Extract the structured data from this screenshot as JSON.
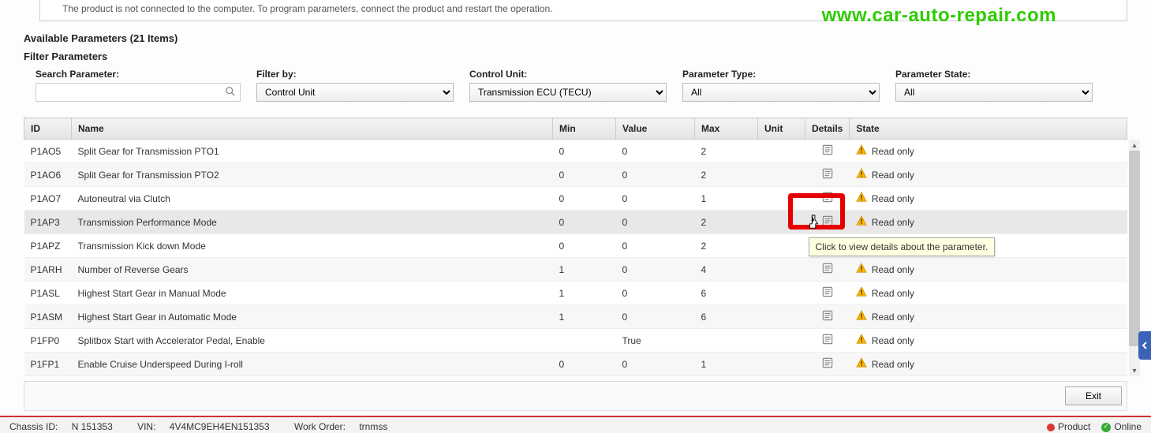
{
  "notice_text": "The product is not connected to the computer. To program parameters, connect the product and restart the operation.",
  "watermark": "www.car-auto-repair.com",
  "available_title": "Available Parameters (21 Items)",
  "filter_title": "Filter Parameters",
  "filters": {
    "search_label": "Search Parameter:",
    "search_value": "",
    "filterby_label": "Filter by:",
    "filterby_value": "Control Unit",
    "controlunit_label": "Control Unit:",
    "controlunit_value": "Transmission ECU (TECU)",
    "ptype_label": "Parameter Type:",
    "ptype_value": "All",
    "pstate_label": "Parameter State:",
    "pstate_value": "All"
  },
  "columns": {
    "id": "ID",
    "name": "Name",
    "min": "Min",
    "value": "Value",
    "max": "Max",
    "unit": "Unit",
    "details": "Details",
    "state": "State"
  },
  "state_readonly": "Read only",
  "rows": [
    {
      "id": "P1AO5",
      "name": "Split Gear for Transmission PTO1",
      "min": "0",
      "value": "0",
      "max": "2",
      "unit": ""
    },
    {
      "id": "P1AO6",
      "name": "Split Gear for Transmission PTO2",
      "min": "0",
      "value": "0",
      "max": "2",
      "unit": ""
    },
    {
      "id": "P1AO7",
      "name": "Autoneutral via Clutch",
      "min": "0",
      "value": "0",
      "max": "1",
      "unit": ""
    },
    {
      "id": "P1AP3",
      "name": "Transmission Performance Mode",
      "min": "0",
      "value": "0",
      "max": "2",
      "unit": ""
    },
    {
      "id": "P1APZ",
      "name": "Transmission Kick down Mode",
      "min": "0",
      "value": "0",
      "max": "2",
      "unit": ""
    },
    {
      "id": "P1ARH",
      "name": "Number of Reverse Gears",
      "min": "1",
      "value": "0",
      "max": "4",
      "unit": ""
    },
    {
      "id": "P1ASL",
      "name": "Highest Start Gear in Manual Mode",
      "min": "1",
      "value": "0",
      "max": "6",
      "unit": ""
    },
    {
      "id": "P1ASM",
      "name": "Highest Start Gear in Automatic Mode",
      "min": "1",
      "value": "0",
      "max": "6",
      "unit": ""
    },
    {
      "id": "P1FP0",
      "name": "Splitbox Start with Accelerator Pedal, Enable",
      "min": "",
      "value": "True",
      "max": "",
      "unit": ""
    },
    {
      "id": "P1FP1",
      "name": "Enable Cruise Underspeed During I-roll",
      "min": "0",
      "value": "0",
      "max": "1",
      "unit": ""
    }
  ],
  "tooltip_text": "Click to view details about the parameter.",
  "exit_label": "Exit",
  "statusbar": {
    "chassis_label": "Chassis ID:",
    "chassis_value": "N 151353",
    "vin_label": "VIN:",
    "vin_value": "4V4MC9EH4EN151353",
    "workorder_label": "Work Order:",
    "workorder_value": "trnmss",
    "product_label": "Product",
    "online_label": "Online"
  }
}
